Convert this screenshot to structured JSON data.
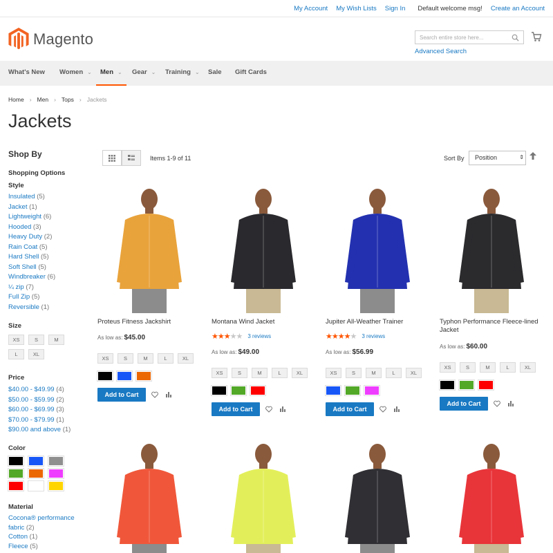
{
  "header": {
    "links": [
      "My Account",
      "My Wish Lists",
      "Sign In"
    ],
    "welcome": "Default welcome msg!",
    "create_account": "Create an Account",
    "logo_text": "Magento",
    "search_placeholder": "Search entire store here...",
    "advanced_search": "Advanced Search"
  },
  "nav": {
    "items": [
      {
        "label": "What's New",
        "dropdown": false
      },
      {
        "label": "Women",
        "dropdown": true
      },
      {
        "label": "Men",
        "dropdown": true,
        "active": true
      },
      {
        "label": "Gear",
        "dropdown": true
      },
      {
        "label": "Training",
        "dropdown": true
      },
      {
        "label": "Sale",
        "dropdown": false
      },
      {
        "label": "Gift Cards",
        "dropdown": false
      }
    ]
  },
  "breadcrumb": [
    "Home",
    "Men",
    "Tops",
    "Jackets"
  ],
  "page_title": "Jackets",
  "sidebar": {
    "shop_by": "Shop By",
    "shopping_options": "Shopping Options",
    "style_title": "Style",
    "styles": [
      {
        "label": "Insulated",
        "count": "(5)"
      },
      {
        "label": "Jacket",
        "count": "(1)"
      },
      {
        "label": "Lightweight",
        "count": "(6)"
      },
      {
        "label": "Hooded",
        "count": "(3)"
      },
      {
        "label": "Heavy Duty",
        "count": "(2)"
      },
      {
        "label": "Rain Coat",
        "count": "(5)"
      },
      {
        "label": "Hard Shell",
        "count": "(5)"
      },
      {
        "label": "Soft Shell",
        "count": "(5)"
      },
      {
        "label": "Windbreaker",
        "count": "(6)"
      },
      {
        "label": "¼ zip",
        "count": "(7)"
      },
      {
        "label": "Full Zip",
        "count": "(5)"
      },
      {
        "label": "Reversible",
        "count": "(1)"
      }
    ],
    "size_title": "Size",
    "sizes": [
      "XS",
      "S",
      "M",
      "L",
      "XL"
    ],
    "price_title": "Price",
    "prices": [
      {
        "label": "$40.00 - $49.99",
        "count": "(4)"
      },
      {
        "label": "$50.00 - $59.99",
        "count": "(2)"
      },
      {
        "label": "$60.00 - $69.99",
        "count": "(3)"
      },
      {
        "label": "$70.00 - $79.99",
        "count": "(1)"
      },
      {
        "label": "$90.00 and above",
        "count": "(1)"
      }
    ],
    "color_title": "Color",
    "colors": [
      "#000000",
      "#1857f7",
      "#8f8f8f",
      "#53a828",
      "#eb6703",
      "#ef3dff",
      "#ff0000",
      "#ffffff",
      "#ffd500"
    ],
    "material_title": "Material",
    "materials": [
      {
        "label": "Cocona® performance fabric",
        "count": "(2)"
      },
      {
        "label": "Cotton",
        "count": "(1)"
      },
      {
        "label": "Fleece",
        "count": "(5)"
      }
    ]
  },
  "toolbar": {
    "items_count": "Items 1-9 of 11",
    "sort_label": "Sort By",
    "sort_value": "Position"
  },
  "products": [
    {
      "name": "Proteus Fitness Jackshirt",
      "price_label": "As low as:",
      "price": "$45.00",
      "rating": 0,
      "reviews": "",
      "sizes": [
        "XS",
        "S",
        "M",
        "L",
        "XL"
      ],
      "colors": [
        "#000000",
        "#1857f7",
        "#eb6703"
      ],
      "add_to_cart": "Add to Cart"
    },
    {
      "name": "Montana Wind Jacket",
      "price_label": "As low as:",
      "price": "$49.00",
      "rating": 2.5,
      "reviews": "3 reviews",
      "sizes": [
        "XS",
        "S",
        "M",
        "L",
        "XL"
      ],
      "colors": [
        "#000000",
        "#53a828",
        "#ff0000"
      ],
      "add_to_cart": "Add to Cart"
    },
    {
      "name": "Jupiter All-Weather Trainer",
      "price_label": "As low as:",
      "price": "$56.99",
      "rating": 4,
      "reviews": "3 reviews",
      "sizes": [
        "XS",
        "S",
        "M",
        "L",
        "XL"
      ],
      "colors": [
        "#1857f7",
        "#53a828",
        "#ef3dff"
      ],
      "add_to_cart": "Add to Cart"
    },
    {
      "name": "Typhon Performance Fleece-lined Jacket",
      "price_label": "As low as:",
      "price": "$60.00",
      "rating": 0,
      "reviews": "",
      "sizes": [
        "XS",
        "S",
        "M",
        "L",
        "XL"
      ],
      "colors": [
        "#000000",
        "#53a828",
        "#ff0000"
      ],
      "add_to_cart": "Add to Cart"
    }
  ],
  "product_images": [
    "#e9a33b",
    "#2a2a2e",
    "#2331b0",
    "#2b2b2e",
    "#f0573a",
    "#e3ef5a",
    "#303034",
    "#e8353a"
  ]
}
